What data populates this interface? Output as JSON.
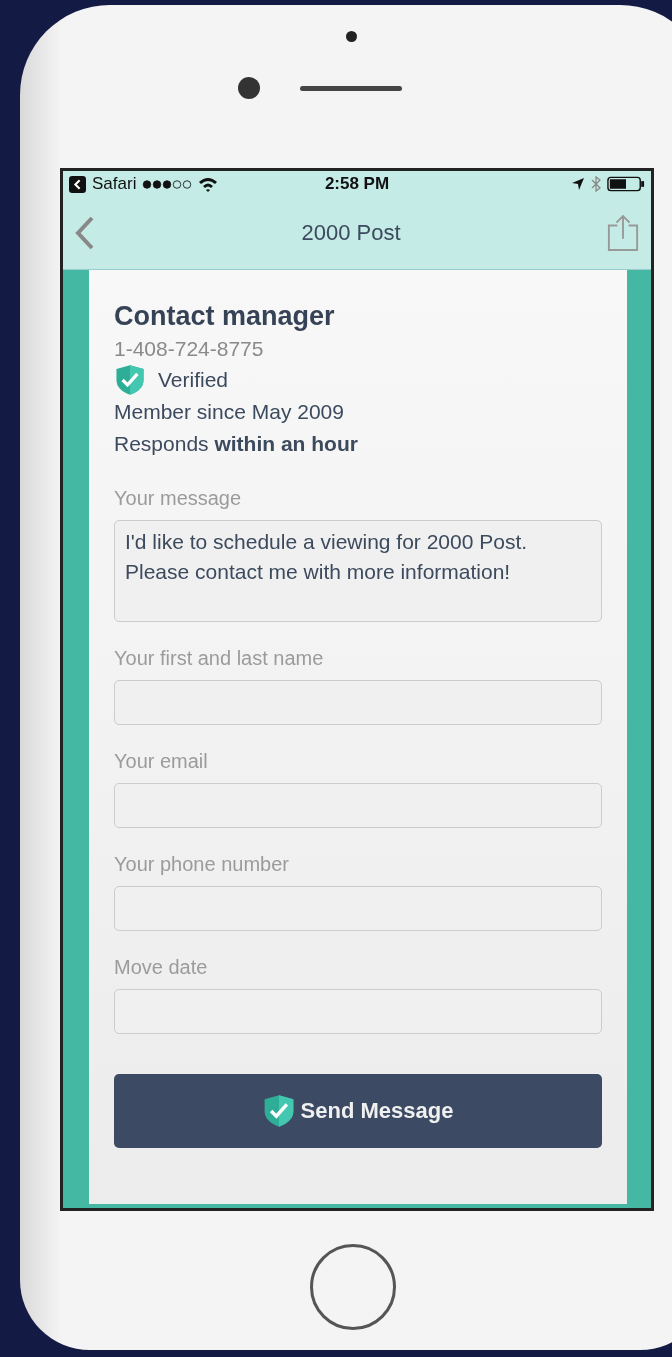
{
  "status_bar": {
    "back_app": "Safari",
    "time": "2:58 PM"
  },
  "nav": {
    "title": "2000 Post"
  },
  "contact": {
    "title": "Contact manager",
    "phone": "1-408-724-8775",
    "verified": "Verified",
    "member_since": "Member since May 2009",
    "responds": "Responds **within an hour**"
  },
  "fields": [
    {
      "kind": "textarea",
      "label": "Your message",
      "value": "I'd like to schedule a viewing for 2000 Post. Please contact me with more information!"
    },
    {
      "kind": "text",
      "label": "Your first and last name"
    },
    {
      "kind": "text",
      "label": "Your email"
    },
    {
      "kind": "text",
      "label": "Your phone number"
    },
    {
      "kind": "text",
      "label": "Move date"
    }
  ],
  "send_button": "Send Message"
}
